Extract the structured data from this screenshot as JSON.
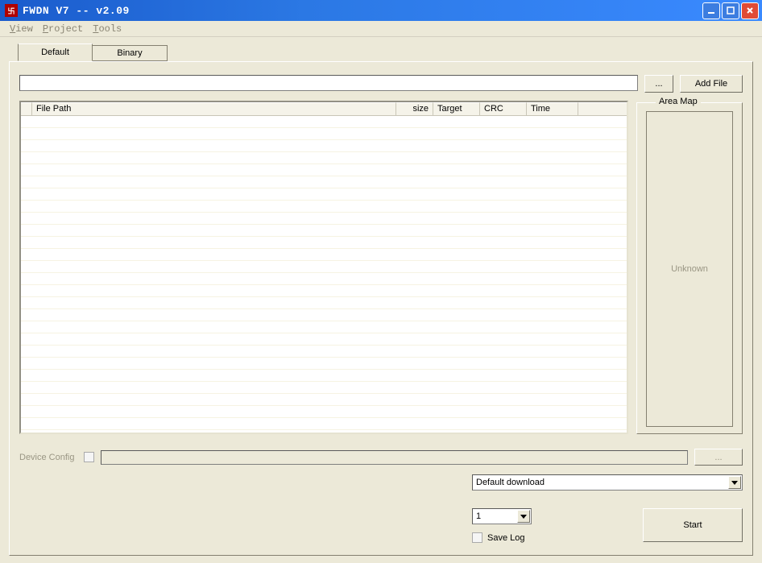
{
  "window": {
    "title": "FWDN V7 -- v2.09"
  },
  "menu": {
    "view": "View",
    "project": "Project",
    "tools": "Tools"
  },
  "tabs": {
    "default": "Default",
    "binary": "Binary"
  },
  "toolbar": {
    "path_value": "",
    "browse_label": "...",
    "add_file_label": "Add File"
  },
  "table": {
    "columns": {
      "file_path": "File Path",
      "size": "size",
      "target": "Target",
      "crc": "CRC",
      "time": "Time"
    },
    "rows": []
  },
  "area_map": {
    "group_label": "Area Map",
    "status": "Unknown"
  },
  "device": {
    "label": "Device Config",
    "checked": false,
    "value": "",
    "browse_label": "..."
  },
  "download": {
    "mode": "Default download",
    "count": "1",
    "save_log_label": "Save Log",
    "save_log_checked": false,
    "start_label": "Start"
  }
}
